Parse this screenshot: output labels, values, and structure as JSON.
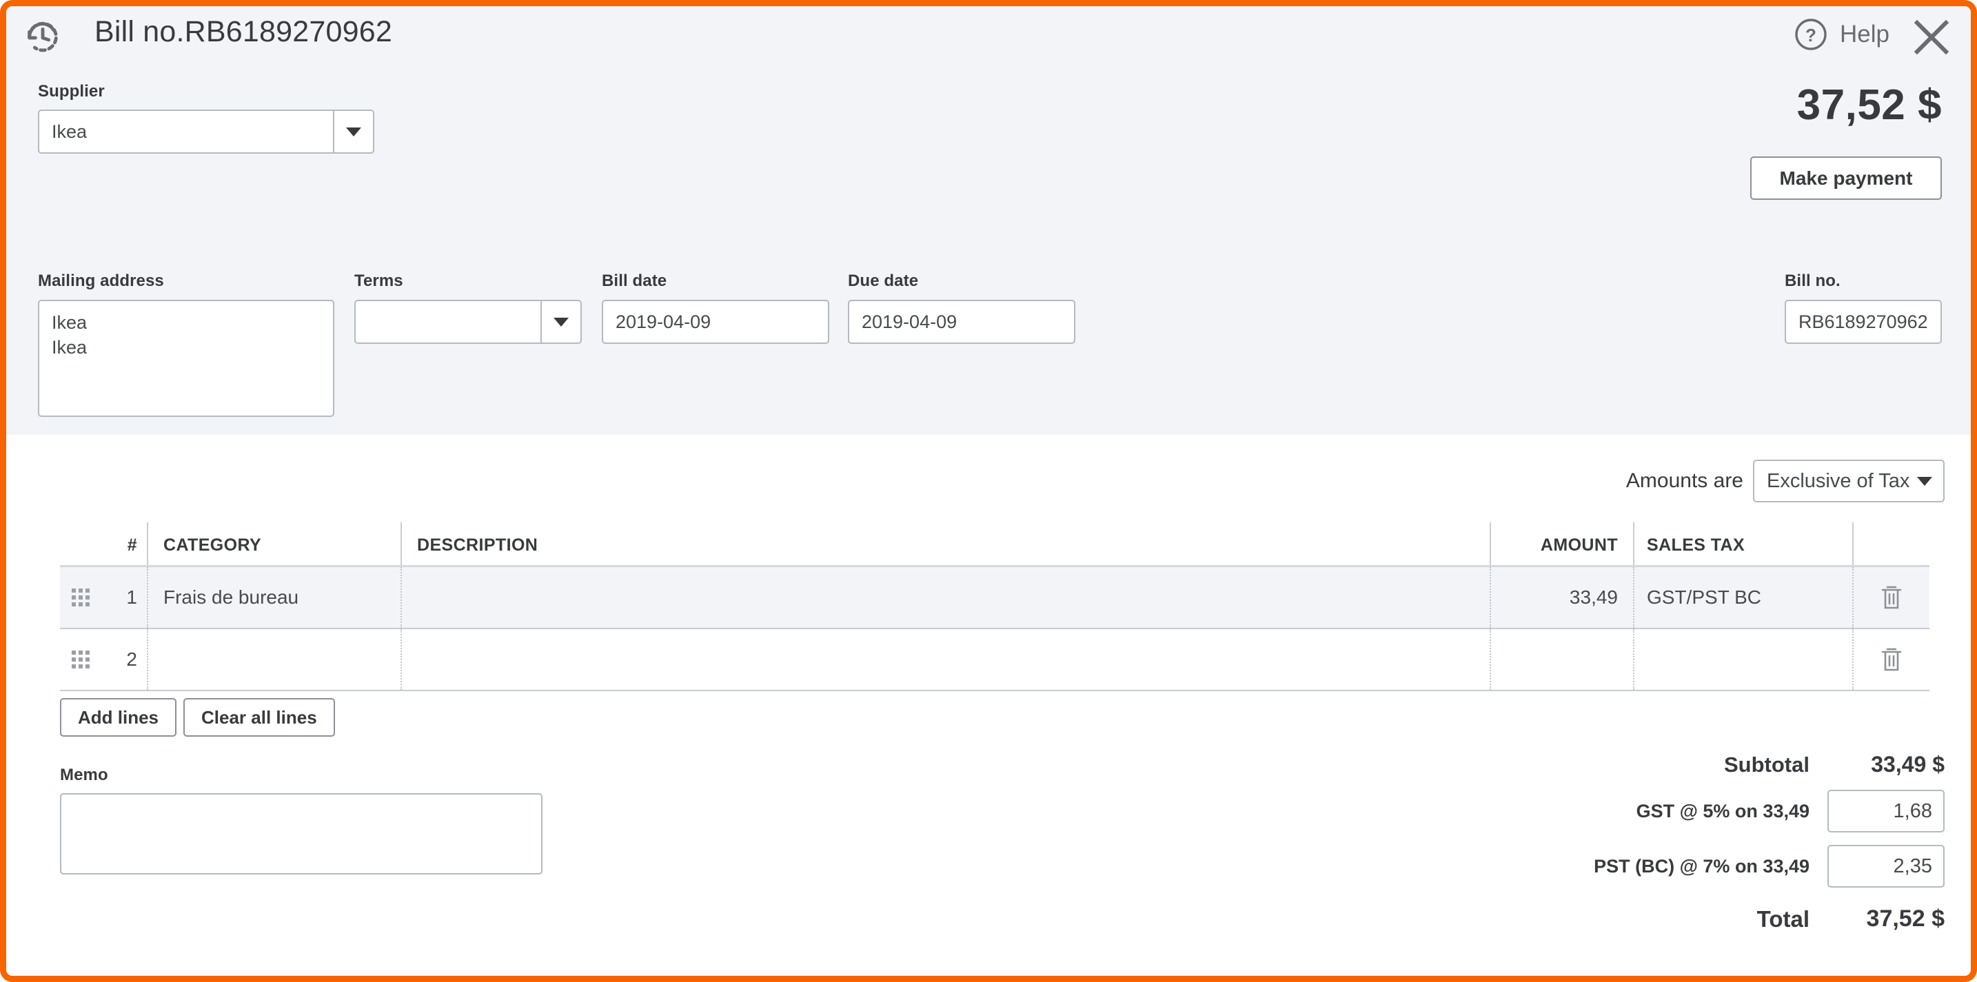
{
  "header": {
    "history_icon": "history-clock-icon",
    "title": "Bill no.RB6189270962",
    "help_label": "Help",
    "help_icon": "question-circle-icon",
    "close_icon": "close-x-icon"
  },
  "supplier": {
    "label": "Supplier",
    "value": "Ikea",
    "placeholder": ""
  },
  "balance": {
    "amount": "37,52 $",
    "make_payment_label": "Make payment"
  },
  "fields": {
    "mailing_address": {
      "label": "Mailing address",
      "value": "Ikea\nIkea"
    },
    "terms": {
      "label": "Terms",
      "value": "",
      "placeholder": ""
    },
    "bill_date": {
      "label": "Bill date",
      "value": "2019-04-09"
    },
    "due_date": {
      "label": "Due date",
      "value": "2019-04-09"
    },
    "bill_no": {
      "label": "Bill no.",
      "value": "RB6189270962"
    }
  },
  "tax_mode": {
    "label": "Amounts are",
    "value": "Exclusive of Tax"
  },
  "line_table": {
    "columns": {
      "num": "#",
      "category": "CATEGORY",
      "description": "DESCRIPTION",
      "amount": "AMOUNT",
      "sales_tax": "SALES TAX"
    },
    "rows": [
      {
        "num": "1",
        "category": "Frais de bureau",
        "description": "",
        "amount": "33,49",
        "sales_tax": "GST/PST BC",
        "handle_icon": "drag-handle-icon",
        "delete_icon": "trash-icon"
      },
      {
        "num": "2",
        "category": "",
        "description": "",
        "amount": "",
        "sales_tax": "",
        "handle_icon": "drag-handle-icon",
        "delete_icon": "trash-icon"
      }
    ]
  },
  "line_actions": {
    "add_lines": "Add lines",
    "clear_all_lines": "Clear all lines"
  },
  "memo": {
    "label": "Memo",
    "value": "",
    "placeholder": ""
  },
  "totals": {
    "subtotal_label": "Subtotal",
    "subtotal_value": "33,49 $",
    "gst_label": "GST @ 5% on 33,49",
    "gst_value": "1,68",
    "pst_label": "PST (BC) @ 7% on 33,49",
    "pst_value": "2,35",
    "total_label": "Total",
    "total_value": "37,52 $"
  },
  "colors": {
    "accent_border": "#f76400",
    "panel_bg": "#f2f4f7",
    "text": "#393a3d",
    "field_border": "#b4b9c2"
  }
}
